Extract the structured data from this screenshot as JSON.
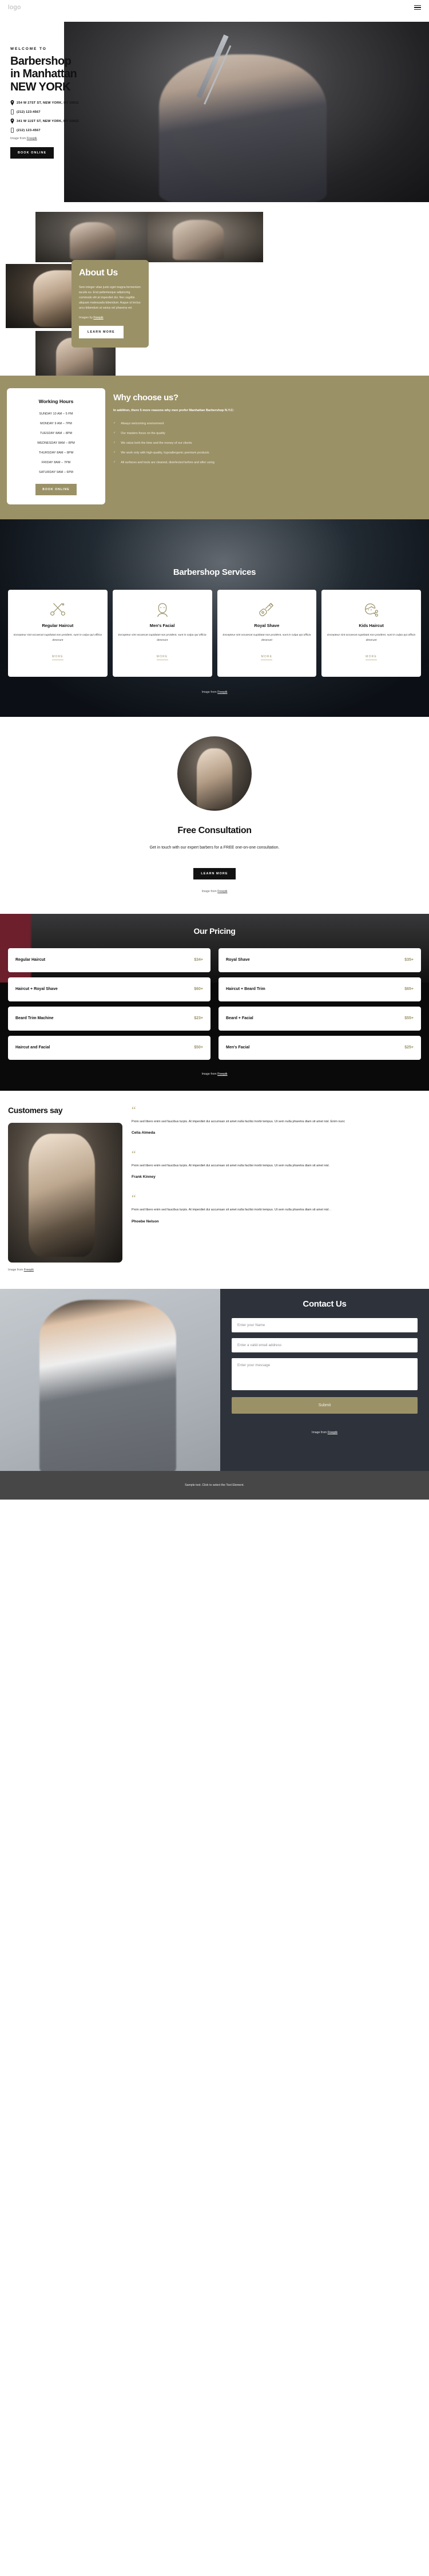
{
  "header": {
    "logo": "logo",
    "menu_icon": "hamburger-icon"
  },
  "hero": {
    "eyebrow": "WELCOME TO",
    "title_line1": "Barbershop",
    "title_line2": "in Manhattan",
    "title_line3": "NEW YORK",
    "contacts": [
      {
        "icon": "map-pin-icon",
        "text": "254 W 27ST ST, NEW YORK, NY 10011"
      },
      {
        "icon": "phone-icon",
        "text": "(212) 123-4567"
      },
      {
        "icon": "map-pin-icon",
        "text": "341 W 11ST ST, NEW YORK, NY 10022"
      },
      {
        "icon": "phone-icon",
        "text": "(212) 123-4567"
      }
    ],
    "credit_prefix": "Image from ",
    "credit_link": "Freepik",
    "cta": "BOOK ONLINE"
  },
  "about": {
    "title": "About Us",
    "text": "Sem integer vitae justo eget magna fermentum iaculis eu. Erat pellentesque adipiscing commodo elit at imperdiet dui. Nec sagittis aliquam malesuada bibendum. Augue ut lectus arcu bibendum at varius vel pharetra vel.",
    "credit_prefix": "Images by ",
    "credit_link": "Freepik",
    "cta": "LEARN MORE"
  },
  "hours": {
    "title": "Working Hours",
    "rows": [
      "SUNDAY 10 AM – 5 PM",
      "MONDAY 9 AM – 7PM",
      "TUESDAY 8AM – 8PM",
      "WEDNESDAY 8AM – 8PM",
      "THURSDAY 8AM – 8PM",
      "FRIDAY 8AM – 7PM",
      "SATURDAY 9AM – 6PM"
    ],
    "cta": "BOOK ONLINE"
  },
  "why": {
    "title": "Why choose us?",
    "subtitle": "In addition, there 5 more reasons why men prefer Manhattan Barbershop N.Y.C:",
    "items": [
      "Always welcoming environment",
      "Our masters focus on the quality",
      "We value both the time and the money of our clients",
      "We work only with high-quality, hypoallergenic premium products",
      "All surfaces and tools are cleaned, disinfected before and after using"
    ]
  },
  "services": {
    "title": "Barbershop Services",
    "more_label": "MORE",
    "credit_prefix": "Image from ",
    "credit_link": "Freepik",
    "cards": [
      {
        "icon": "scissors-icon",
        "name": "Regular Haircut",
        "desc": "Excepteur sint occaecat cupidatat non proident, sunt in culpa qui officia deserunt"
      },
      {
        "icon": "bearded-man-icon",
        "name": "Men's Facial",
        "desc": "Excepteur sint occaecat cupidatat non proident, sunt in culpa qui officia deserunt"
      },
      {
        "icon": "razor-icon",
        "name": "Royal Shave",
        "desc": "Excepteur sint occaecat cupidatat non proident, sunt in culpa qui officia deserunt"
      },
      {
        "icon": "kid-haircut-icon",
        "name": "Kids Haircut",
        "desc": "Excepteur sint occaecat cupidatat non proident, sunt in culpa qui officia deserunt"
      }
    ]
  },
  "consultation": {
    "title": "Free Consultation",
    "subtitle": "Get in touch with our expert barbers for a FREE one-on-one consultation.",
    "cta": "LEARN MORE",
    "credit_prefix": "Image from ",
    "credit_link": "Freepik"
  },
  "pricing": {
    "title": "Our Pricing",
    "credit_prefix": "Image from ",
    "credit_link": "Freepik",
    "rows": [
      {
        "label": "Regular Haircut",
        "price": "$34+"
      },
      {
        "label": "Royal Shave",
        "price": "$35+"
      },
      {
        "label": "Haircut + Royal Shave",
        "price": "$60+"
      },
      {
        "label": "Haircut + Beard Trim",
        "price": "$65+"
      },
      {
        "label": "Beard Trim Machine",
        "price": "$23+"
      },
      {
        "label": "Beard + Facial",
        "price": "$55+"
      },
      {
        "label": "Haircut and Facial",
        "price": "$50+"
      },
      {
        "label": "Men's Facial",
        "price": "$25+"
      }
    ]
  },
  "testimonials": {
    "heading": "Customers say",
    "quote_glyph": "“",
    "credit_prefix": "Image from ",
    "credit_link": "Freepik",
    "items": [
      {
        "text": "Proin sed libero enim sed faucibus turpis. At imperdiet dui accumsan sit amet nulla facilisi morbi tempus. Ut sem nulla pharetra diam sit amet nisl. Enim nunc",
        "name": "Celia Almeda"
      },
      {
        "text": "Proin sed libero enim sed faucibus turpis. At imperdiet dui accumsan sit amet nulla facilisi morbi tempus. Ut sem nulla pharetra diam sit amet nisl.",
        "name": "Frank Kinney"
      },
      {
        "text": "Proin sed libero enim sed faucibus turpis. At imperdiet dui accumsan sit amet nulla facilisi morbi tempus. Ut sem nulla pharetra diam sit amet nisl. .",
        "name": "Phoebe Nelson"
      }
    ]
  },
  "contact": {
    "title": "Contact Us",
    "name_placeholder": "Enter your Name",
    "email_placeholder": "Enter a valid email address",
    "message_placeholder": "Enter your message",
    "submit_label": "Submit",
    "credit_prefix": "Image from ",
    "credit_link": "Freepik"
  },
  "footer": {
    "text": "Sample text. Click to select the Text Element."
  },
  "colors": {
    "olive": "#9b9167",
    "dark": "#111111",
    "footer": "#474747",
    "contact_bg": "#2e333b"
  }
}
